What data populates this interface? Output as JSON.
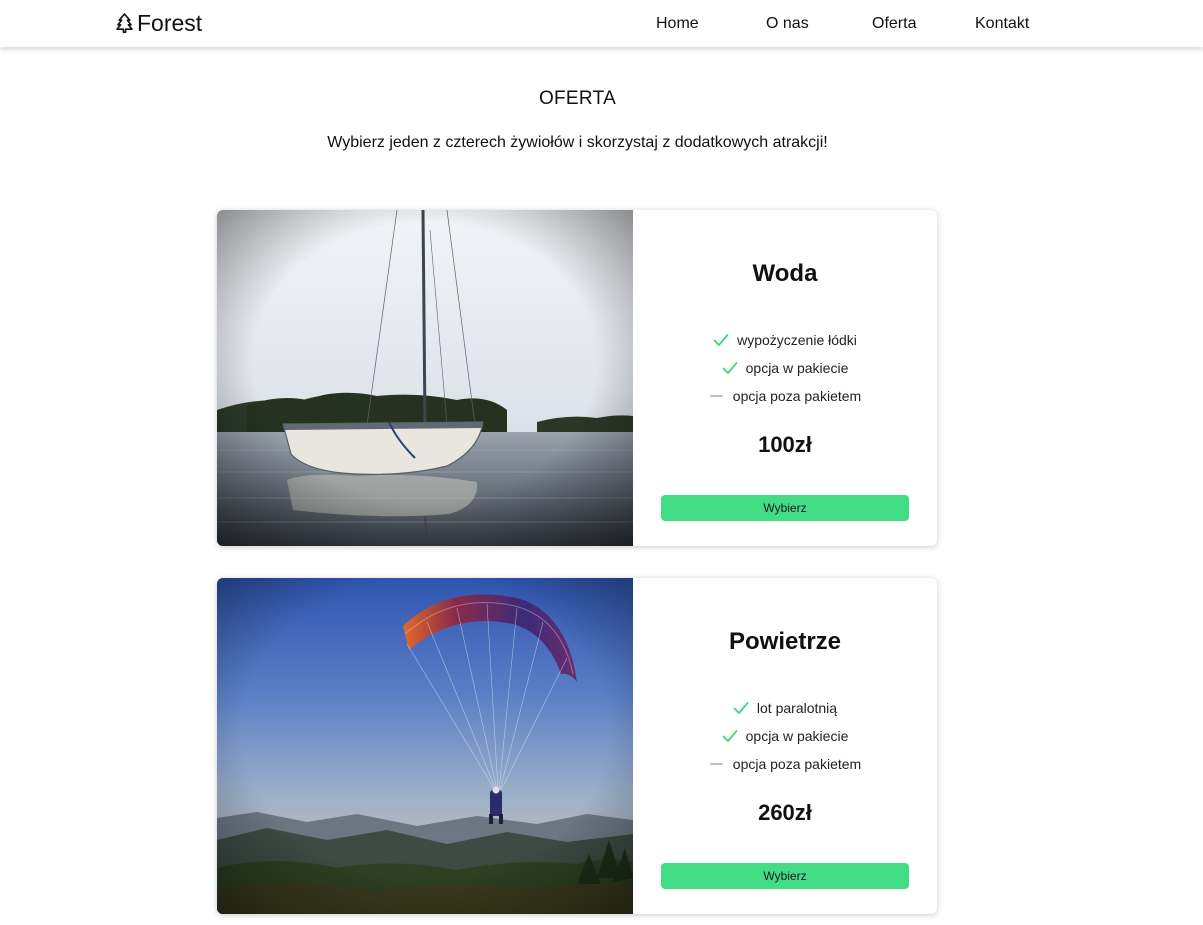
{
  "navbar": {
    "brand": "Forest",
    "brand_icon": "tree-icon",
    "links": [
      "Home",
      "O nas",
      "Oferta",
      "Kontakt"
    ]
  },
  "offer": {
    "title": "OFERTA",
    "subtitle": "Wybierz jeden z czterech żywiołów i skorzystaj z dodatkowych atrakcji!"
  },
  "colors": {
    "accent": "#42dd84",
    "check": "#3fd67d",
    "dash": "#b5b5b5"
  },
  "cards": [
    {
      "title": "Woda",
      "image": "sailboat-on-lake-photo",
      "features": [
        {
          "icon": "check-icon",
          "text": "wypożyczenie łódki"
        },
        {
          "icon": "check-icon",
          "text": "opcja w pakiecie"
        },
        {
          "icon": "dash-icon",
          "text": "opcja poza pakietem"
        }
      ],
      "price": "100zł",
      "button": "Wybierz"
    },
    {
      "title": "Powietrze",
      "image": "paraglider-over-mountains-photo",
      "features": [
        {
          "icon": "check-icon",
          "text": "lot paralotnią"
        },
        {
          "icon": "check-icon",
          "text": "opcja w pakiecie"
        },
        {
          "icon": "dash-icon",
          "text": "opcja poza pakietem"
        }
      ],
      "price": "260zł",
      "button": "Wybierz"
    }
  ]
}
